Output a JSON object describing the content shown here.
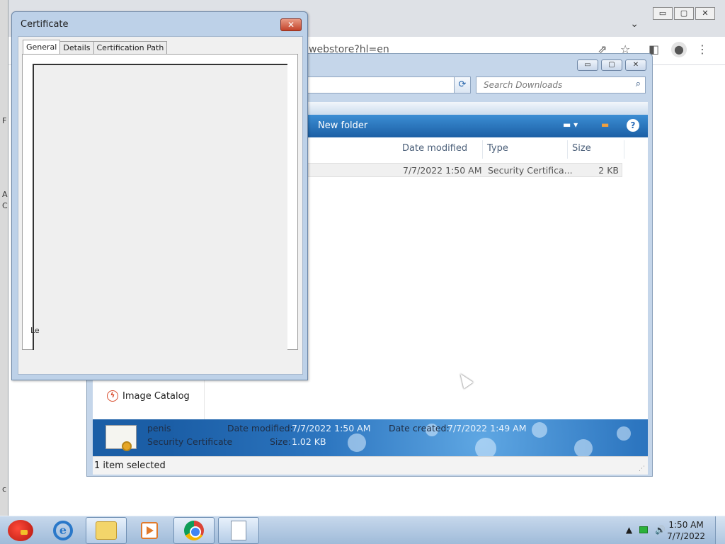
{
  "desktop": {
    "edge_chars": [
      "F",
      "A",
      "C",
      "c"
    ]
  },
  "browser": {
    "url_fragment": "webstore?hl=en",
    "controls": {
      "minimize": "▭",
      "maximize": "▢",
      "close": "✕"
    },
    "tab_menu": "⌄"
  },
  "explorer": {
    "controls": {
      "minimize": "▭",
      "maximize": "▢",
      "close": "✕"
    },
    "search_placeholder": "Search Downloads",
    "toolbar": {
      "new_folder": "New folder",
      "help": "?"
    },
    "columns": [
      "Date modified",
      "Type",
      "Size"
    ],
    "file": {
      "date_modified": "7/7/2022 1:50 AM",
      "type": "Security Certifica...",
      "size": "2 KB"
    },
    "nav": {
      "image_catalog": "Image Catalog"
    },
    "details": {
      "name": "penis",
      "type": "Security Certificate",
      "date_modified_label": "Date modified:",
      "date_modified": "7/7/2022 1:50 AM",
      "date_created_label": "Date created:",
      "date_created": "7/7/2022 1:49 AM",
      "size_label": "Size:",
      "size": "1.02 KB"
    },
    "status": "1 item selected"
  },
  "certificate_dialog": {
    "title": "Certificate",
    "close": "✕",
    "tabs": [
      "General",
      "Details",
      "Certification Path"
    ],
    "active_tab": "General",
    "truncated_link": "Le"
  },
  "taskbar": {
    "clock_time": "1:50 AM",
    "clock_date": "7/7/2022",
    "tray_up_arrow": "▲",
    "tray_volume": "🔊"
  },
  "colors": {
    "toolbar_blue": "#1c5fa5",
    "details_blue": "#2d76c0",
    "close_red": "#c2422a",
    "taskbar": "#b3cbe6"
  }
}
